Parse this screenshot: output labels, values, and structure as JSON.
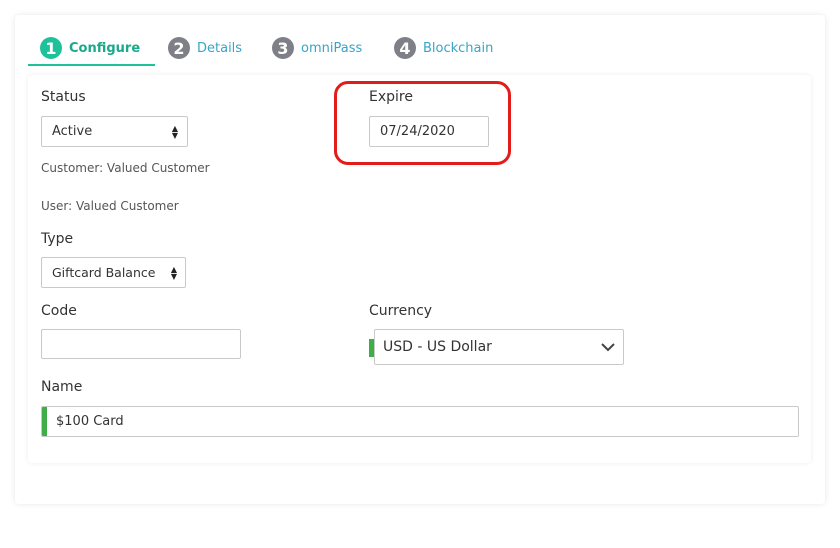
{
  "wizard": {
    "steps": [
      {
        "number": "1",
        "label": "Configure",
        "active": true
      },
      {
        "number": "2",
        "label": "Details",
        "active": false
      },
      {
        "number": "3",
        "label": "omniPass",
        "active": false
      },
      {
        "number": "4",
        "label": "Blockchain",
        "active": false
      }
    ]
  },
  "form": {
    "status": {
      "label": "Status",
      "value": "Active"
    },
    "expire": {
      "label": "Expire",
      "value": "07/24/2020"
    },
    "customer_text": "Customer: Valued Customer",
    "user_text": "User: Valued Customer",
    "type": {
      "label": "Type",
      "value": "Giftcard Balance"
    },
    "code": {
      "label": "Code",
      "value": ""
    },
    "currency": {
      "label": "Currency",
      "value": "USD - US Dollar"
    },
    "name": {
      "label": "Name",
      "value": "$100 Card"
    }
  },
  "colors": {
    "accent_green": "#1ec29a",
    "tab_link_blue": "#39a4c8",
    "required_bar_green": "#3fae49",
    "highlight_red": "#e21b1b"
  }
}
